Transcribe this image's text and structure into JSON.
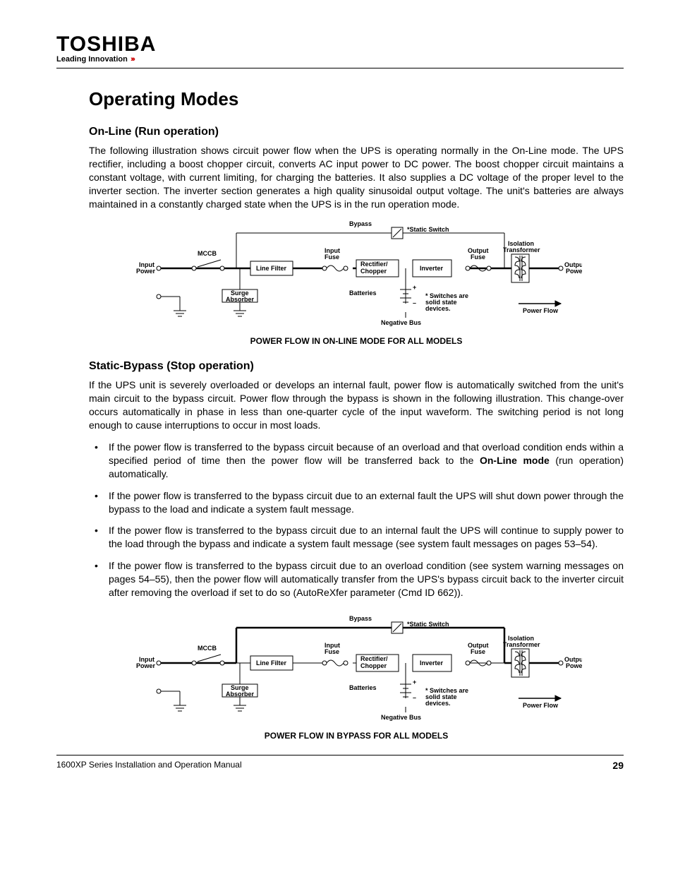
{
  "brand": {
    "name": "TOSHIBA",
    "tagline": "Leading Innovation"
  },
  "title": "Operating Modes",
  "section1": {
    "heading": "On-Line (Run operation)",
    "para": "The following illustration shows circuit power flow when the UPS is operating normally in the On-Line mode. The UPS rectifier, including a boost chopper circuit, converts AC input power to DC power. The boost chopper circuit maintains a constant voltage, with current limiting, for charging the batteries. It also supplies a DC voltage of the proper level to the inverter section. The inverter section generates a high quality sinusoidal output voltage. The unit's batteries are always maintained in a constantly charged state when the UPS is in the run operation mode.",
    "caption": "POWER FLOW IN ON-LINE MODE FOR ALL MODELS"
  },
  "section2": {
    "heading": "Static-Bypass (Stop operation)",
    "para": "If the UPS unit is severely overloaded or develops an internal fault, power flow is automatically switched from the unit's main circuit to the bypass circuit. Power flow through the bypass is shown in the following illustration. This change-over occurs automatically in phase in less than one-quarter cycle of the input waveform. The switching period is not long enough to cause interruptions to occur in most loads.",
    "bullets": {
      "b1a": "If the power flow is transferred to the bypass circuit because of an overload and that overload condition ends within a specified period of time then the power flow will be transferred back to the ",
      "b1b": "On-Line mode",
      "b1c": " (run operation) automatically.",
      "b2": "If the power flow is transferred to the bypass circuit due to an external fault the UPS will shut down power through the bypass to the load and indicate a system fault message.",
      "b3": "If the power flow is transferred to the bypass circuit due to an internal fault the UPS will continue to supply power to the load through the bypass and indicate a system fault message (see system fault messages on pages 53–54).",
      "b4": "If the power flow is transferred to the bypass circuit due to an overload condition (see system warning messages on pages 54–55), then the power flow will automatically transfer from the UPS's bypass circuit back to the inverter circuit after removing the overload if set to do so (AutoReXfer parameter (Cmd ID 662))."
    },
    "caption": "POWER FLOW IN BYPASS FOR ALL MODELS"
  },
  "diagram_labels": {
    "bypass": "Bypass",
    "static_switch": "*Static Switch",
    "isolation_transformer": "Isolation Transformer",
    "mccb": "MCCB",
    "input_fuse": "Input Fuse",
    "output_fuse": "Output Fuse",
    "input_power": "Input Power",
    "output_power": "Output Power",
    "line_filter": "Line Filter",
    "rectifier_chopper": "Rectifier/ Chopper",
    "inverter": "Inverter",
    "surge_absorber": "Surge Absorber",
    "batteries": "Batteries",
    "switches_note": "* Switches are solid state devices.",
    "power_flow": "Power Flow",
    "negative_bus": "Negative  Bus",
    "plus": "+",
    "minus": "–"
  },
  "footer": {
    "left": "1600XP Series Installation and Operation Manual",
    "page": "29"
  }
}
